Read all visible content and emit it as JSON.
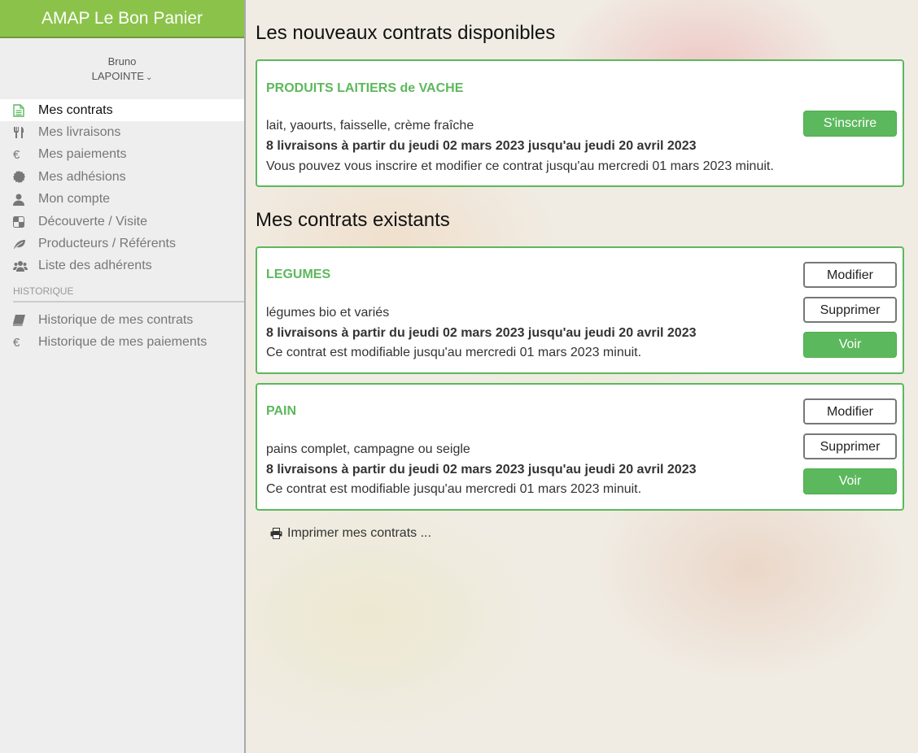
{
  "sidebar": {
    "brand": "AMAP Le Bon Panier",
    "user": {
      "first_name": "Bruno",
      "last_name": "LAPOINTE"
    },
    "menu": [
      {
        "label": "Mes contrats",
        "icon": "document-icon"
      },
      {
        "label": "Mes livraisons",
        "icon": "cutlery-icon"
      },
      {
        "label": "Mes paiements",
        "icon": "euro-icon"
      },
      {
        "label": "Mes adhésions",
        "icon": "badge-icon"
      },
      {
        "label": "Mon compte",
        "icon": "user-icon"
      },
      {
        "label": "Découverte / Visite",
        "icon": "checker-icon"
      },
      {
        "label": "Producteurs / Référents",
        "icon": "leaf-icon"
      },
      {
        "label": "Liste des adhérents",
        "icon": "users-icon"
      }
    ],
    "history_header": "HISTORIQUE",
    "history": [
      {
        "label": "Historique de mes contrats",
        "icon": "book-icon"
      },
      {
        "label": "Historique de mes paiements",
        "icon": "euro-icon"
      }
    ]
  },
  "main": {
    "new_contracts_title": "Les nouveaux contrats disponibles",
    "new_contracts": [
      {
        "title": "PRODUITS LAITIERS de VACHE",
        "description": "lait, yaourts, faisselle, crème fraîche",
        "deliveries": "8 livraisons à partir du jeudi 02 mars 2023 jusqu'au jeudi 20 avril 2023",
        "note": "Vous pouvez vous inscrire et modifier ce contrat jusqu'au mercredi 01 mars 2023 minuit.",
        "button": "S'inscrire"
      }
    ],
    "existing_contracts_title": "Mes contrats existants",
    "existing_contracts": [
      {
        "title": "LEGUMES",
        "description": "légumes bio et variés",
        "deliveries": "8 livraisons à partir du jeudi 02 mars 2023 jusqu'au jeudi 20 avril 2023",
        "note": "Ce contrat est modifiable jusqu'au mercredi 01 mars 2023 minuit.",
        "buttons": {
          "modify": "Modifier",
          "delete": "Supprimer",
          "view": "Voir"
        }
      },
      {
        "title": "PAIN",
        "description": "pains complet, campagne ou seigle",
        "deliveries": "8 livraisons à partir du jeudi 02 mars 2023 jusqu'au jeudi 20 avril 2023",
        "note": "Ce contrat est modifiable jusqu'au mercredi 01 mars 2023 minuit.",
        "buttons": {
          "modify": "Modifier",
          "delete": "Supprimer",
          "view": "Voir"
        }
      }
    ],
    "print_label": "Imprimer mes contrats ..."
  },
  "colors": {
    "brand": "#8bc34a",
    "accent": "#5cb85c",
    "sidebar_bg": "#eeeeee"
  }
}
